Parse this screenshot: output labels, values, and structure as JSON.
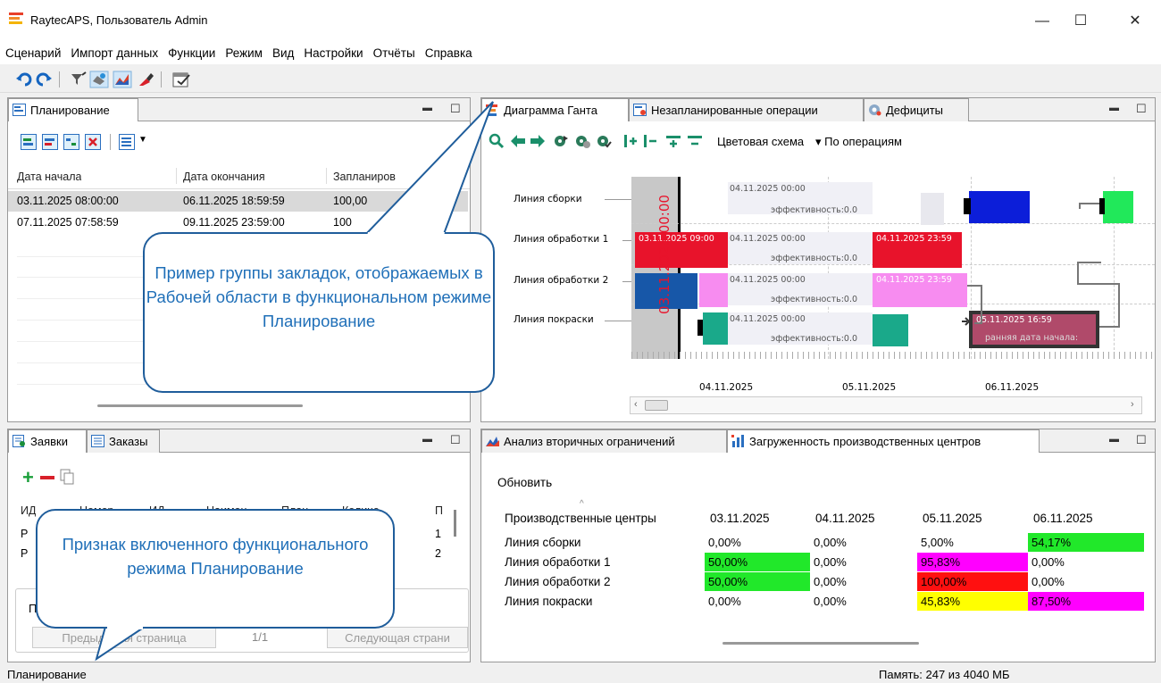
{
  "window": {
    "title": "RaytecAPS, Пользователь Admin",
    "minimize": "—",
    "maximize": "☐",
    "close": "✕"
  },
  "menu": [
    "Сценарий",
    "Импорт данных",
    "Функции",
    "Режим",
    "Вид",
    "Настройки",
    "Отчёты",
    "Справка"
  ],
  "planning": {
    "tab": "Планирование",
    "columns": [
      "Дата начала",
      "Дата окончания",
      "Запланиров"
    ],
    "rows": [
      [
        "03.11.2025 08:00:00",
        "06.11.2025 18:59:59",
        "100,00"
      ],
      [
        "07.11.2025 07:58:59",
        "09.11.2025 23:59:00",
        "100"
      ]
    ]
  },
  "gantt_tabs": [
    "Диаграмма Ганта",
    "Незапланированные операции",
    "Дефициты"
  ],
  "gantt": {
    "color_scheme_label": "Цветовая схема",
    "color_scheme_value": "▾ По операциям",
    "lines": [
      "Линия сборки",
      "Линия обработки 1",
      "Линия обработки 2",
      "Линия покраски"
    ],
    "now_label": "03.11.2025 00:00",
    "date_labels": [
      "04.11.2025",
      "05.11.2025",
      "06.11.2025"
    ],
    "bar_texts": {
      "a1": "04.11.2025 00:00",
      "a2": "эффективность:0.0",
      "b0": "03.11.2025 09:00",
      "b1": "04.11.2025 00:00",
      "b2": "эффективность:0.0",
      "b3": "04.11.2025 23:59",
      "c1": "04.11.2025 00:00",
      "c2": "эффективность:0.0",
      "c3": "04.11.2025 23:59",
      "d1": "04.11.2025 00:00",
      "d2": "эффективность:0.0",
      "d3": "05.11.2025 16:59",
      "d4": "ранняя дата начала:"
    },
    "colors": {
      "red": "#e8132b",
      "blue": "#0c1ed9",
      "green": "#21e85a",
      "pink": "#f78cf0",
      "teal": "#1aa98a",
      "darkblue": "#1757a8",
      "maroon": "#b04a6a"
    }
  },
  "orders": {
    "tabs": [
      "Заявки",
      "Заказы"
    ],
    "columns": [
      "ИД",
      "Номер",
      "ИД",
      "Наимен",
      "План",
      "Количе...",
      "П"
    ],
    "rows": [
      [
        "Р",
        "",
        "",
        "",
        "",
        "",
        "1"
      ],
      [
        "Р",
        "",
        "",
        "",
        "",
        "",
        "2"
      ]
    ],
    "page_label": "П",
    "prev": "Предыдущая страница",
    "page_info": "1/1",
    "next": "Следующая страни"
  },
  "load": {
    "tabs": [
      "Анализ вторичных ограничений",
      "Загруженность производственных центров"
    ],
    "refresh": "Обновить",
    "columns": [
      "Производственные центры",
      "03.11.2025",
      "04.11.2025",
      "05.11.2025",
      "06.11.2025"
    ],
    "rows": [
      {
        "name": "Линия сборки",
        "vals": [
          "0,00%",
          "0,00%",
          "5,00%",
          "54,17%"
        ],
        "bg": [
          "",
          "",
          "",
          "#21e82a"
        ]
      },
      {
        "name": "Линия обработки 1",
        "vals": [
          "50,00%",
          "0,00%",
          "95,83%",
          "0,00%"
        ],
        "bg": [
          "#21e82a",
          "",
          "#ff00ff",
          ""
        ]
      },
      {
        "name": "Линия обработки 2",
        "vals": [
          "50,00%",
          "0,00%",
          "100,00%",
          "0,00%"
        ],
        "bg": [
          "#21e82a",
          "",
          "#ff1010",
          ""
        ]
      },
      {
        "name": "Линия покраски",
        "vals": [
          "0,00%",
          "0,00%",
          "45,83%",
          "87,50%"
        ],
        "bg": [
          "",
          "",
          "#ffff00",
          "#ff00ff"
        ]
      }
    ]
  },
  "callouts": {
    "top": "Пример группы закладок, отображаемых в Рабочей области в функциональном режиме Планирование",
    "bottom": "Признак включенного функционального режима Планирование"
  },
  "status": {
    "mode": "Планирование",
    "memory": "Память: 247 из 4040 МБ"
  }
}
